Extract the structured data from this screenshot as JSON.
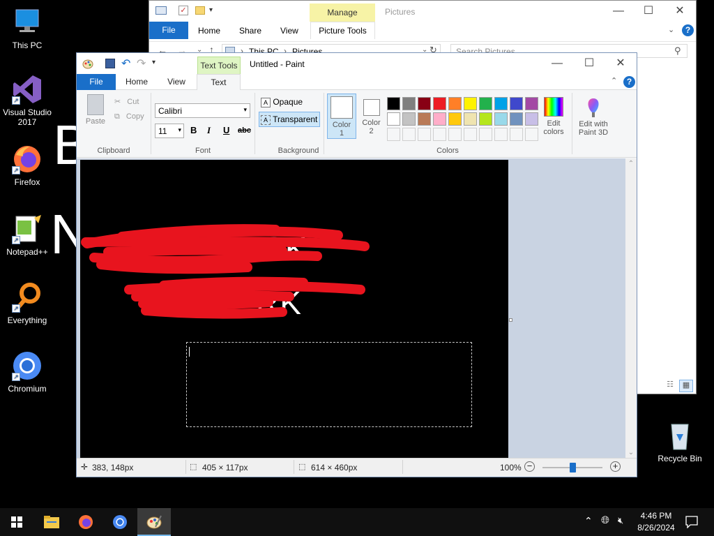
{
  "desktop": {
    "icons": [
      {
        "label": "This PC"
      },
      {
        "label": "Visual Studio 2017"
      },
      {
        "label": "Firefox"
      },
      {
        "label": "Notepad++"
      },
      {
        "label": "Everything"
      },
      {
        "label": "Chromium"
      },
      {
        "label": "Recycle Bin"
      }
    ]
  },
  "explorer": {
    "manage_tab": "Manage",
    "title": "Pictures",
    "tabs": [
      "File",
      "Home",
      "Share",
      "View",
      "Picture Tools"
    ],
    "breadcrumb": [
      "This PC",
      "Pictures"
    ],
    "search_placeholder": "Search Pictures"
  },
  "paint": {
    "title": "Untitled - Paint",
    "context_tab": "Text Tools",
    "tabs": [
      "File",
      "Home",
      "View",
      "Text"
    ],
    "clipboard": {
      "paste": "Paste",
      "cut": "Cut",
      "copy": "Copy",
      "label": "Clipboard"
    },
    "font": {
      "family": "Calibri",
      "size": "11",
      "bold": "B",
      "italic": "I",
      "underline": "U",
      "strike": "abc",
      "label": "Font"
    },
    "background": {
      "opaque": "Opaque",
      "transparent": "Transparent",
      "label": "Background"
    },
    "colors": {
      "color1": "Color 1",
      "color2": "Color 2",
      "edit_colors": "Edit colors",
      "edit_paint3d": "Edit with Paint 3D",
      "label": "Colors",
      "row1": [
        "#000000",
        "#7f7f7f",
        "#880015",
        "#ed1c24",
        "#ff7f27",
        "#fff200",
        "#22b14c",
        "#00a2e8",
        "#3f48cc",
        "#a349a4"
      ],
      "row2": [
        "#ffffff",
        "#c3c3c3",
        "#b97a57",
        "#ffaec9",
        "#ffc90e",
        "#efe4b0",
        "#b5e61d",
        "#99d9ea",
        "#7092be",
        "#c8bfe7"
      ]
    },
    "canvas_text": {
      "line1_visible": "ACK",
      "line2_visible": "RK"
    },
    "status": {
      "cursor_pos": "383, 148px",
      "selection_size": "405 × 117px",
      "image_size": "614 × 460px",
      "zoom": "100%",
      "zoom_level": 0.5
    }
  },
  "taskbar": {
    "time": "4:46 PM",
    "date": "8/26/2024"
  }
}
